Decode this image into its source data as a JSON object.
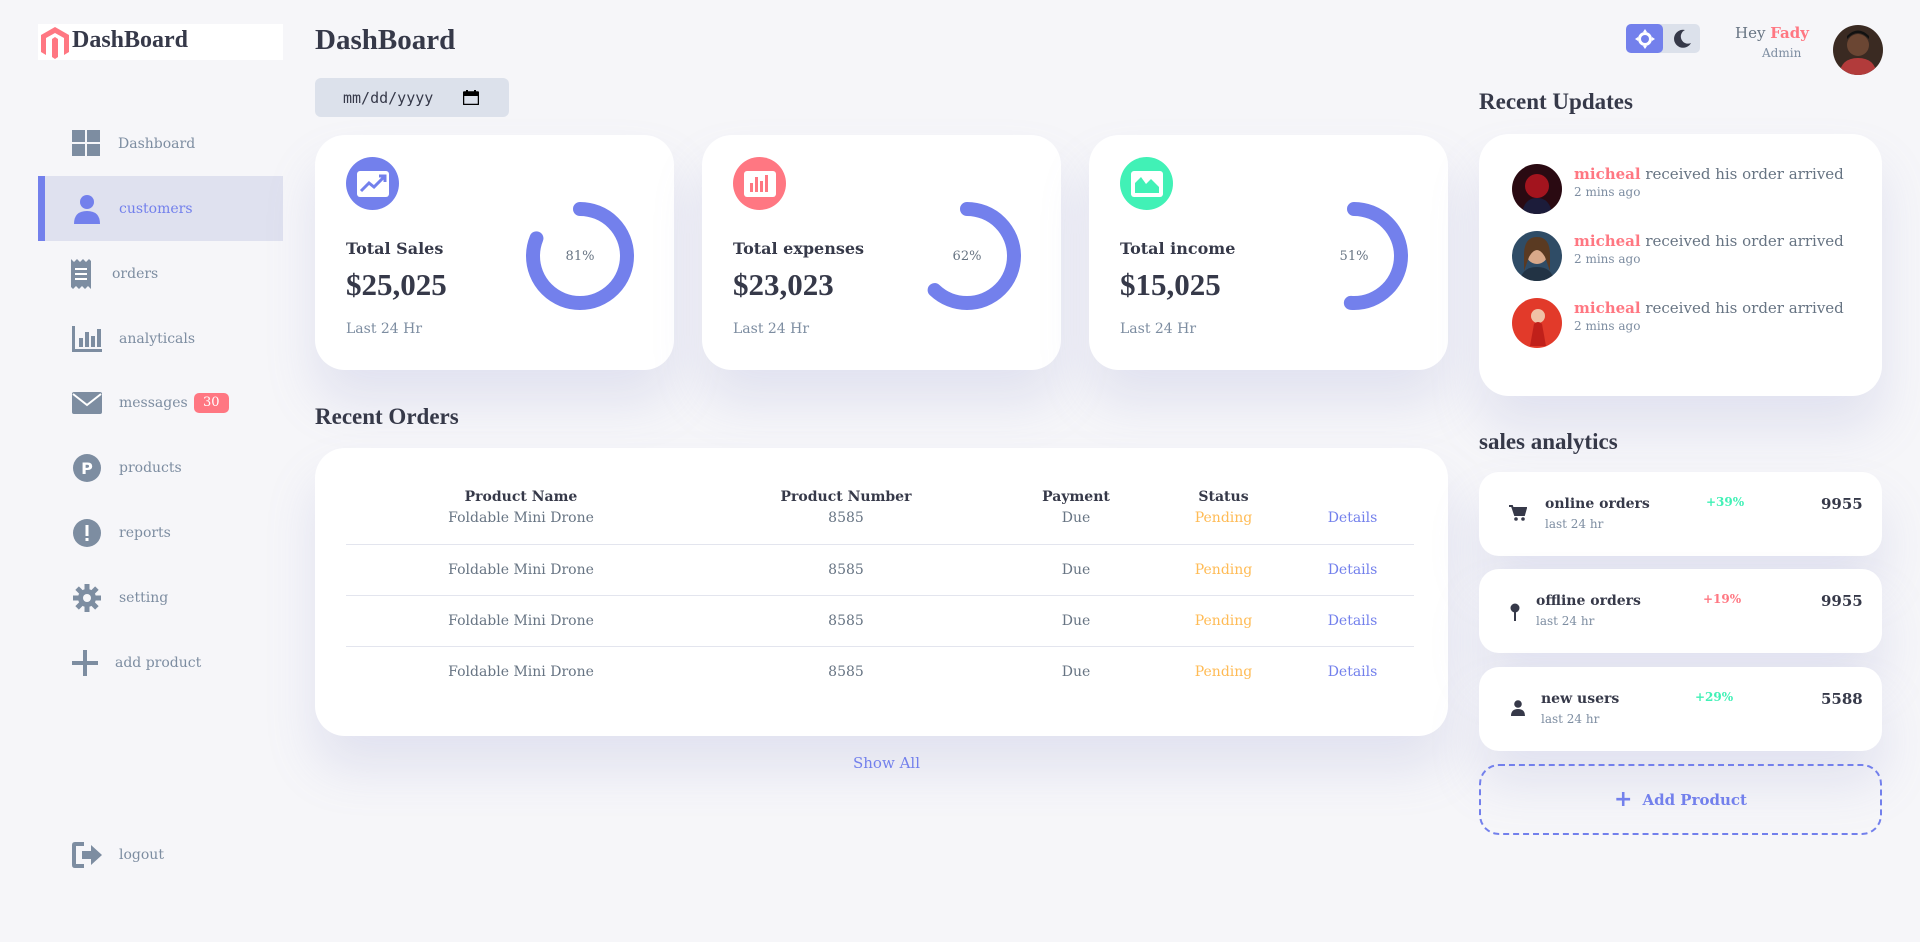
{
  "app": {
    "logo_text": "DashBoard",
    "page_title": "DashBoard"
  },
  "colors": {
    "primary": "#7380ec",
    "danger": "#ff7782",
    "success": "#41f1b6",
    "warning": "#ffbb55",
    "background": "#f6f6f9"
  },
  "sidebar": {
    "items": [
      {
        "label": "Dashboard",
        "icon": "grid-icon"
      },
      {
        "label": "customers",
        "icon": "person-icon",
        "active": true
      },
      {
        "label": "orders",
        "icon": "receipt-icon"
      },
      {
        "label": "analyticals",
        "icon": "bar-chart-icon"
      },
      {
        "label": "messages",
        "icon": "mail-icon",
        "badge": "30"
      },
      {
        "label": "products",
        "icon": "product-icon"
      },
      {
        "label": "reports",
        "icon": "report-icon"
      },
      {
        "label": "setting",
        "icon": "gear-icon"
      },
      {
        "label": "add product",
        "icon": "plus-icon"
      }
    ],
    "logout_label": "logout"
  },
  "date_input": {
    "placeholder": "mm/dd/yyyy"
  },
  "cards": [
    {
      "title": "Total Sales",
      "value": "$25,025",
      "sub": "Last 24 Hr",
      "percent": 81,
      "percent_label": "81%",
      "icon": "trend-up-icon",
      "color": "#7380ec"
    },
    {
      "title": "Total expenses",
      "value": "$23,023",
      "sub": "Last 24 Hr",
      "percent": 62,
      "percent_label": "62%",
      "icon": "bar-chart-icon",
      "color": "#ff7782"
    },
    {
      "title": "Total income",
      "value": "$15,025",
      "sub": "Last 24 Hr",
      "percent": 51,
      "percent_label": "51%",
      "icon": "area-chart-icon",
      "color": "#41f1b6"
    }
  ],
  "recent_orders": {
    "title": "Recent Orders",
    "columns": [
      "Product Name",
      "Product Number",
      "Payment",
      "Status",
      ""
    ],
    "rows": [
      [
        "Foldable Mini Drone",
        "8585",
        "Due",
        "Pending",
        "Details"
      ],
      [
        "Foldable Mini Drone",
        "8585",
        "Due",
        "Pending",
        "Details"
      ],
      [
        "Foldable Mini Drone",
        "8585",
        "Due",
        "Pending",
        "Details"
      ],
      [
        "Foldable Mini Drone",
        "8585",
        "Due",
        "Pending",
        "Details"
      ]
    ],
    "show_all": "Show All"
  },
  "top_right": {
    "greeting": "Hey",
    "user_name": "Fady",
    "role": "Admin"
  },
  "recent_updates": {
    "title": "Recent Updates",
    "items": [
      {
        "name": "micheal",
        "message": " received his order arrived",
        "time": "2 mins ago"
      },
      {
        "name": "micheal",
        "message": " received his order arrived",
        "time": "2 mins ago"
      },
      {
        "name": "micheal",
        "message": " received his order arrived",
        "time": "2 mins ago"
      }
    ]
  },
  "sales_analytics": {
    "title": "sales analytics",
    "items": [
      {
        "name": "online orders",
        "sub": "last 24 hr",
        "change": "+39%",
        "value": "9955",
        "change_color": "#41f1b6",
        "icon": "cart-icon"
      },
      {
        "name": "offline orders",
        "sub": "last 24 hr",
        "change": "+19%",
        "value": "9955",
        "change_color": "#ff7782",
        "icon": "pin-icon"
      },
      {
        "name": "new users",
        "sub": "last 24 hr",
        "change": "+29%",
        "value": "5588",
        "change_color": "#41f1b6",
        "icon": "user-icon"
      }
    ],
    "add_product": "Add Product"
  }
}
